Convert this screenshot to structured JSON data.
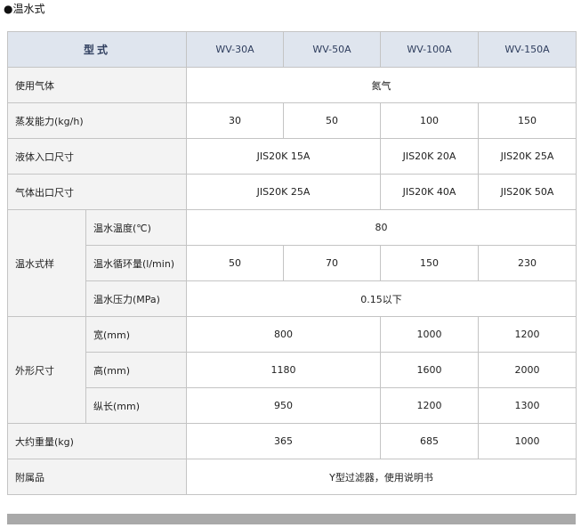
{
  "section": {
    "title": "●温水式"
  },
  "header": {
    "type_label": "型式",
    "models": [
      "WV-30A",
      "WV-50A",
      "WV-100A",
      "WV-150A"
    ]
  },
  "rows": {
    "gas": {
      "label": "使用气体",
      "value": "氮气"
    },
    "evap": {
      "label": "蒸发能力(kg/h)",
      "values": [
        "30",
        "50",
        "100",
        "150"
      ]
    },
    "liquid_inlet": {
      "label": "液体入口尺寸",
      "values": [
        "JIS20K 15A",
        "JIS20K 20A",
        "JIS20K 25A"
      ]
    },
    "gas_outlet": {
      "label": "气体出口尺寸",
      "values": [
        "JIS20K 25A",
        "JIS20K 40A",
        "JIS20K 50A"
      ]
    },
    "warm_spec": {
      "label": "温水式样",
      "temp": {
        "label": "温水温度(℃)",
        "value": "80"
      },
      "flow": {
        "label": "温水循环量(l/min)",
        "values": [
          "50",
          "70",
          "150",
          "230"
        ]
      },
      "pressure": {
        "label": "温水压力(MPa)",
        "value": "0.15以下"
      }
    },
    "dimensions": {
      "label": "外形尺寸",
      "width": {
        "label": "宽(mm)",
        "values": [
          "800",
          "1000",
          "1200"
        ]
      },
      "height": {
        "label": "高(mm)",
        "values": [
          "1180",
          "1600",
          "2000"
        ]
      },
      "length": {
        "label": "纵长(mm)",
        "values": [
          "950",
          "1200",
          "1300"
        ]
      }
    },
    "weight": {
      "label": "大约重量(kg)",
      "values": [
        "365",
        "685",
        "1000"
      ]
    },
    "accessories": {
      "label": "附属品",
      "value": "Y型过滤器，使用说明书"
    }
  }
}
